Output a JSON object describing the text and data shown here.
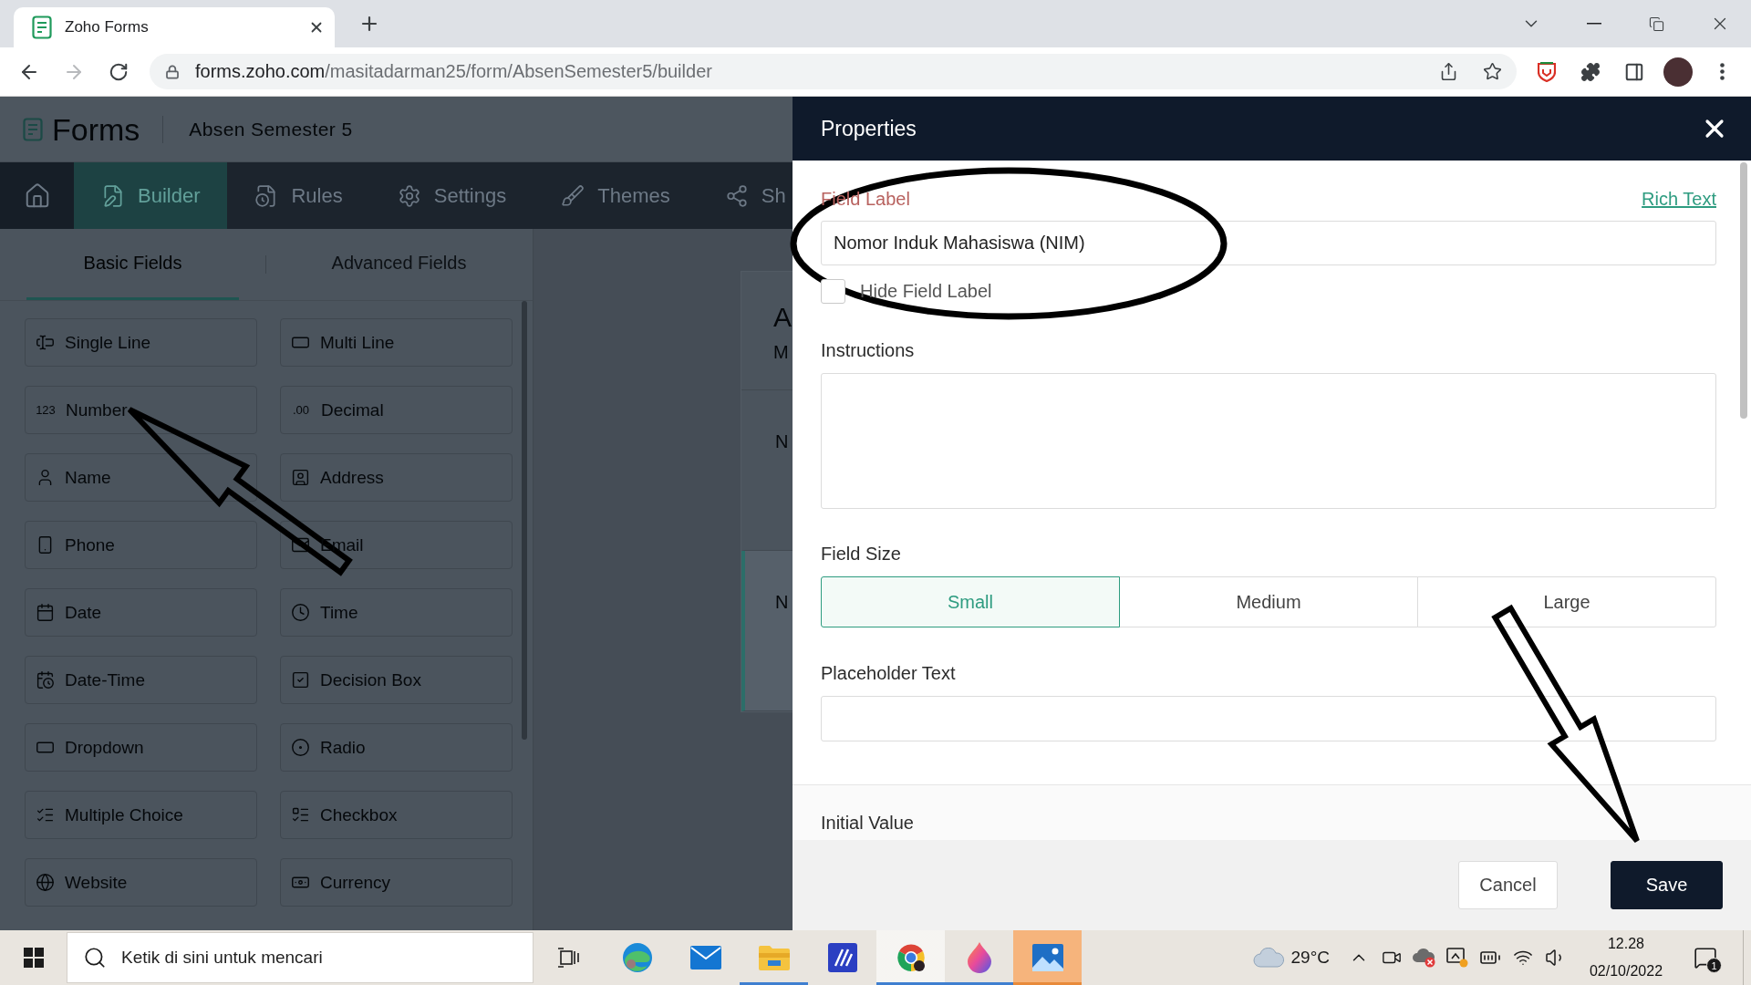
{
  "browser": {
    "tab": {
      "title": "Zoho Forms",
      "selected": true
    },
    "forward": {
      "disabled": true
    },
    "url": {
      "host": "forms.zoho.com",
      "path": "/masitadarman25/form/AbsenSemester5/builder"
    }
  },
  "app": {
    "logo": "Forms",
    "form_name": "Absen Semester 5",
    "nav": [
      {
        "label": "Builder",
        "selected": true
      },
      {
        "label": "Rules",
        "selected": false
      },
      {
        "label": "Settings",
        "selected": false
      },
      {
        "label": "Themes",
        "selected": false
      },
      {
        "label": "Sh",
        "selected": false
      }
    ],
    "field_tabs": [
      {
        "label": "Basic Fields",
        "selected": true
      },
      {
        "label": "Advanced Fields",
        "selected": false
      }
    ],
    "fields": [
      {
        "label": "Single Line"
      },
      {
        "label": "Multi Line"
      },
      {
        "label": "Number",
        "glyph": "123"
      },
      {
        "label": "Decimal",
        "glyph": ".00"
      },
      {
        "label": "Name"
      },
      {
        "label": "Address"
      },
      {
        "label": "Phone"
      },
      {
        "label": "Email"
      },
      {
        "label": "Date"
      },
      {
        "label": "Time"
      },
      {
        "label": "Date-Time"
      },
      {
        "label": "Decision Box"
      },
      {
        "label": "Dropdown"
      },
      {
        "label": "Radio"
      },
      {
        "label": "Multiple Choice"
      },
      {
        "label": "Checkbox"
      },
      {
        "label": "Website"
      },
      {
        "label": "Currency"
      }
    ],
    "form_preview": {
      "title": "A",
      "description": "M",
      "fields": [
        {
          "label": "N",
          "selected": false
        },
        {
          "label": "N",
          "selected": true
        }
      ]
    }
  },
  "properties": {
    "title": "Properties",
    "field_label": {
      "label": "Field Label",
      "highlighted": true,
      "value": "Nomor Induk Mahasiswa (NIM)",
      "link": "Rich Text"
    },
    "hide_field_label": {
      "label": "Hide Field Label",
      "checked": false
    },
    "instructions": {
      "label": "Instructions"
    },
    "field_size": {
      "label": "Field Size",
      "options": [
        {
          "label": "Small",
          "selected": true
        },
        {
          "label": "Medium",
          "selected": false
        },
        {
          "label": "Large",
          "selected": false
        }
      ]
    },
    "placeholder_text": {
      "label": "Placeholder Text"
    },
    "initial_value": {
      "label": "Initial Value"
    },
    "buttons": [
      {
        "label": "Cancel",
        "kind": "secondary"
      },
      {
        "label": "Save",
        "kind": "primary"
      }
    ]
  },
  "taskbar": {
    "search": {
      "placeholder": "Ketik di sini untuk mencari"
    },
    "apps": [
      {
        "running": false,
        "selected": false,
        "flashing": false
      },
      {
        "running": false,
        "selected": false,
        "flashing": false
      },
      {
        "running": true,
        "selected": false,
        "flashing": false
      },
      {
        "running": false,
        "selected": false,
        "flashing": false
      },
      {
        "running": true,
        "selected": true,
        "flashing": false
      },
      {
        "running": true,
        "selected": false,
        "flashing": false
      },
      {
        "running": true,
        "selected": false,
        "flashing": true
      }
    ],
    "weather": {
      "temperature": "29°C"
    },
    "clock": {
      "time": "12.28",
      "date": "02/10/2022"
    },
    "notifications": {
      "count": "1"
    }
  },
  "markup": [
    {
      "kind": "ellipse"
    },
    {
      "kind": "arrow"
    },
    {
      "kind": "arrow"
    }
  ]
}
